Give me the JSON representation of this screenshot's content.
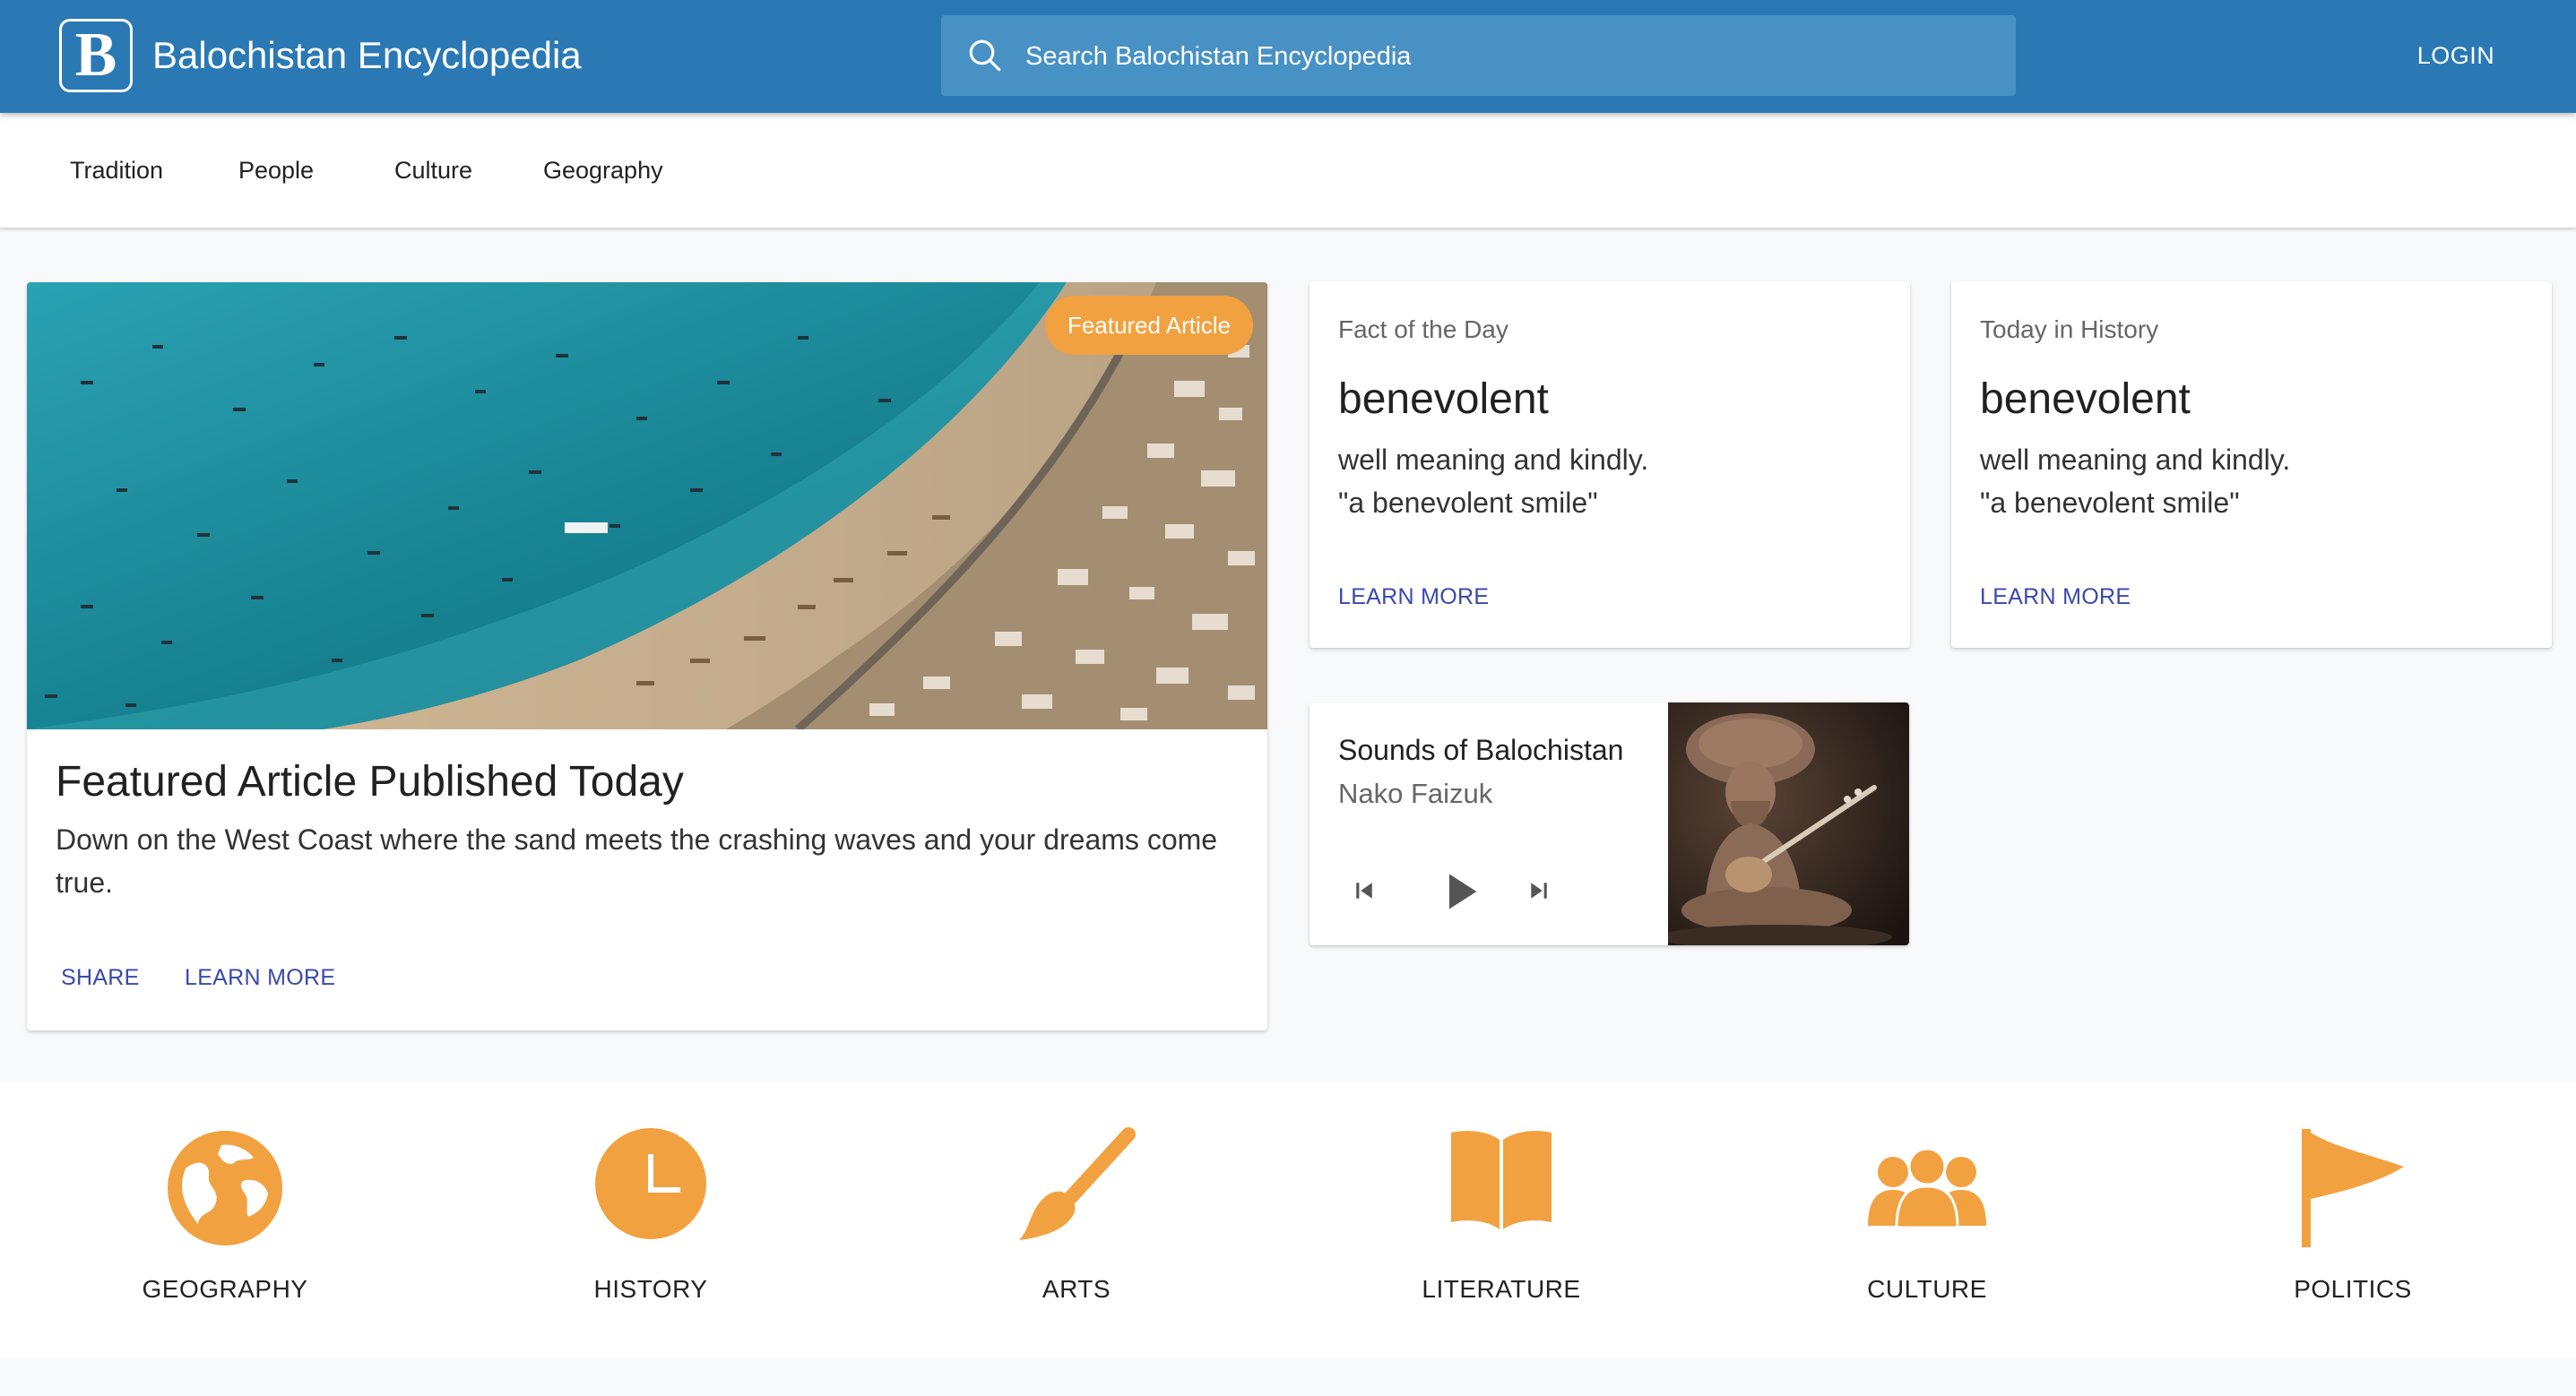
{
  "app": {
    "logo_letter": "B",
    "title": "Balochistan Encyclopedia",
    "search_placeholder": "Search Balochistan Encyclopedia",
    "login_label": "LOGIN"
  },
  "nav": {
    "tabs": [
      {
        "label": "Tradition"
      },
      {
        "label": "People"
      },
      {
        "label": "Culture"
      },
      {
        "label": "Geography"
      }
    ]
  },
  "featured": {
    "badge": "Featured Article",
    "title": "Featured Article Published Today",
    "text": "Down on the West Coast where the sand meets the crashing waves and your dreams come true.",
    "share_label": "SHARE",
    "learn_more_label": "LEARN MORE"
  },
  "fact_of_day": {
    "overline": "Fact of the Day",
    "word": "benevolent",
    "definition": "well meaning and kindly.",
    "example": "\"a benevolent smile\"",
    "learn_more_label": "LEARN MORE"
  },
  "today_in_history": {
    "overline": "Today in History",
    "word": "benevolent",
    "definition": "well meaning and kindly.",
    "example": "\"a benevolent smile\"",
    "learn_more_label": "LEARN MORE"
  },
  "player": {
    "title": "Sounds of Balochistan",
    "artist": "Nako Faizuk",
    "controls": [
      "skip-previous-icon",
      "play-icon",
      "skip-next-icon"
    ]
  },
  "topics": [
    {
      "label": "GEOGRAPHY",
      "icon": "globe-icon"
    },
    {
      "label": "HISTORY",
      "icon": "clock-icon"
    },
    {
      "label": "ARTS",
      "icon": "paintbrush-icon"
    },
    {
      "label": "LITERATURE",
      "icon": "book-icon"
    },
    {
      "label": "CULTURE",
      "icon": "people-icon"
    },
    {
      "label": "POLITICS",
      "icon": "flag-icon"
    }
  ],
  "colors": {
    "appbar": "#2a79b5",
    "search_bg": "#4791c5",
    "accent_orange": "#f2a140",
    "link_blue": "#3949ab"
  }
}
